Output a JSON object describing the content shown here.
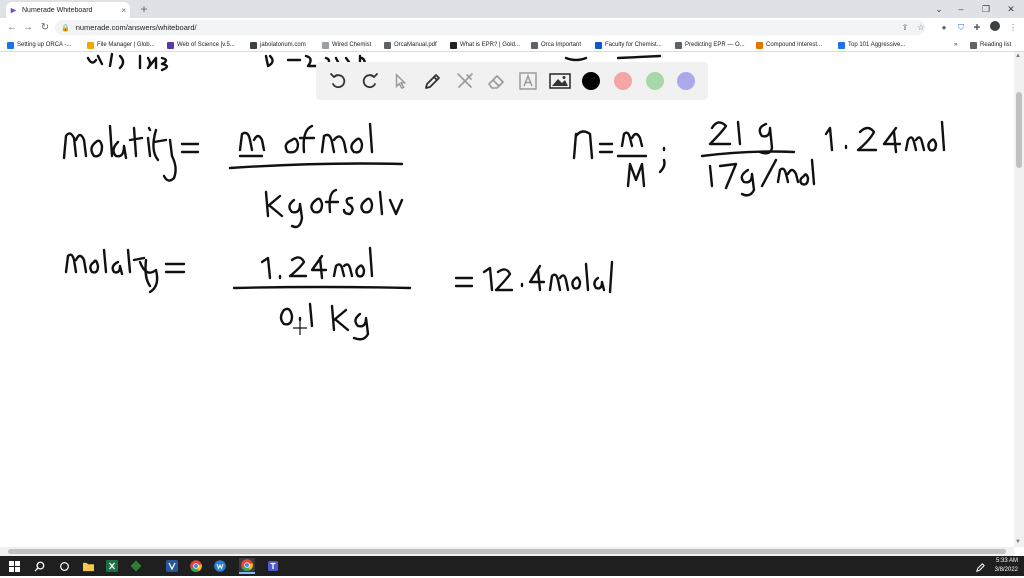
{
  "browser": {
    "tab_title": "Numerade Whiteboard",
    "tab_close": "×",
    "new_tab": "+",
    "url": "numerade.com/answers/whiteboard/",
    "window_controls": {
      "minimize": "–",
      "restore": "❐",
      "close": "✕",
      "tab_search": "⌄"
    },
    "nav": {
      "back": "←",
      "forward": "→",
      "reload": "↻"
    },
    "bookmarks": [
      {
        "label": "Setting up ORCA -...",
        "color": "#1a73e8"
      },
      {
        "label": "File Manager | Glob...",
        "color": "#f2a600"
      },
      {
        "label": "Web of Science [v.5...",
        "color": "#5e35b1"
      },
      {
        "label": "jabolatorium.com",
        "color": "#3c4043"
      },
      {
        "label": "Wired Chemist",
        "color": "#9aa0a6"
      },
      {
        "label": "OrcaManual.pdf",
        "color": "#5f6368"
      },
      {
        "label": "What is EPR? | Gold...",
        "color": "#202124"
      },
      {
        "label": "Orca Important",
        "color": "#5f6368"
      },
      {
        "label": "Faculty for Chemist...",
        "color": "#0b57d0"
      },
      {
        "label": "Predicting EPR — O...",
        "color": "#5f6368"
      },
      {
        "label": "Compound Interest...",
        "color": "#e37400"
      },
      {
        "label": "Top 101 Aggressive...",
        "color": "#1a73e8"
      }
    ],
    "bookmarks_more": "»",
    "reading_list": "Reading list"
  },
  "whiteboard_toolbar": {
    "colors": [
      "#000000",
      "#f4a6a6",
      "#a8d8a8",
      "#a9a9ec"
    ]
  },
  "taskbar": {
    "time": "5:33 AM",
    "date": "3/8/2022"
  }
}
